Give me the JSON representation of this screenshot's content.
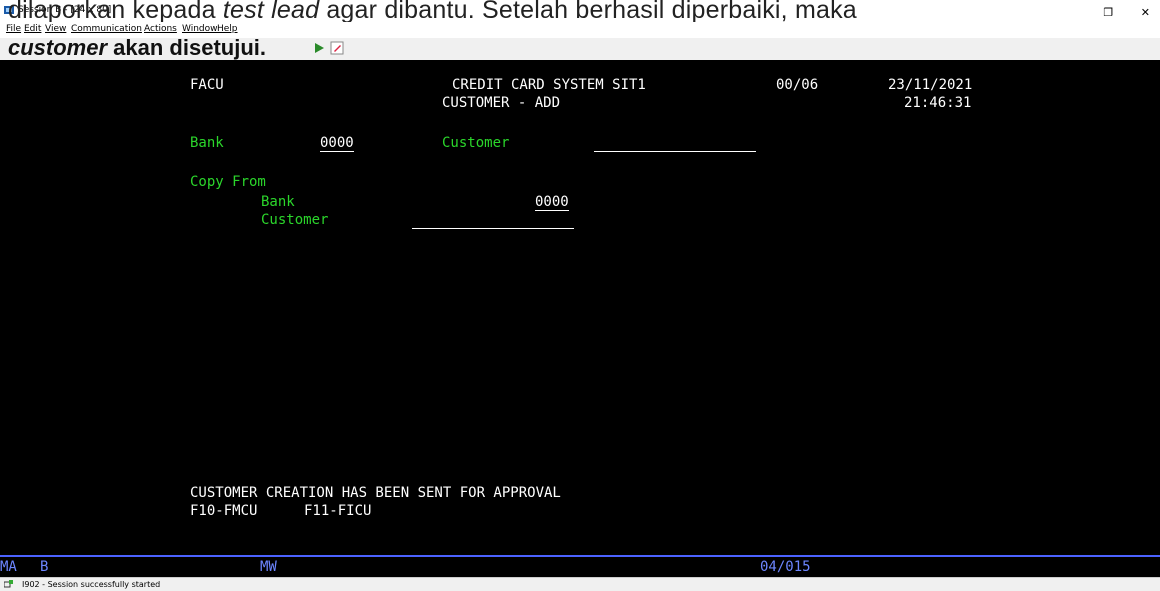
{
  "window": {
    "title": "Session B - [24 x 80]",
    "overlay_line1_a": "dilaporkan kepada ",
    "overlay_line1_b": "test lead",
    "overlay_line1_c": " agar dibantu. Setelah berhasil diperbaiki, maka",
    "overlay_line2_a": "customer",
    "overlay_line2_b": " akan disetujui.",
    "restore": "❐",
    "close": "✕"
  },
  "menu": [
    "File",
    "Edit",
    "View",
    "Communication",
    "Actions",
    "Window",
    "Help"
  ],
  "screen": {
    "program": "FACU",
    "system_title": "CREDIT CARD SYSTEM SIT1",
    "screen_title": "CUSTOMER - ADD",
    "page": "00/06",
    "date": "23/11/2021",
    "time": "21:46:31",
    "bank_label": "Bank",
    "bank_value": "0000",
    "customer_label": "Customer",
    "customer_value": "",
    "copy_from_label": "Copy From",
    "copy_bank_label": "Bank",
    "copy_bank_value": "0000",
    "copy_customer_label": "Customer",
    "copy_customer_value": "",
    "message": "CUSTOMER CREATION HAS BEEN SENT FOR APPROVAL",
    "fkey1": "F10-FMCU",
    "fkey2": "F11-FICU"
  },
  "oia": {
    "ma": "MA",
    "session": "B",
    "mode": "MW",
    "cursor": "04/015"
  },
  "statusbar": {
    "message": "I902 - Session successfully started"
  },
  "colors": {
    "field_label": "#2bd62b",
    "text": "#ffffff",
    "oia": "#6d86ff"
  }
}
